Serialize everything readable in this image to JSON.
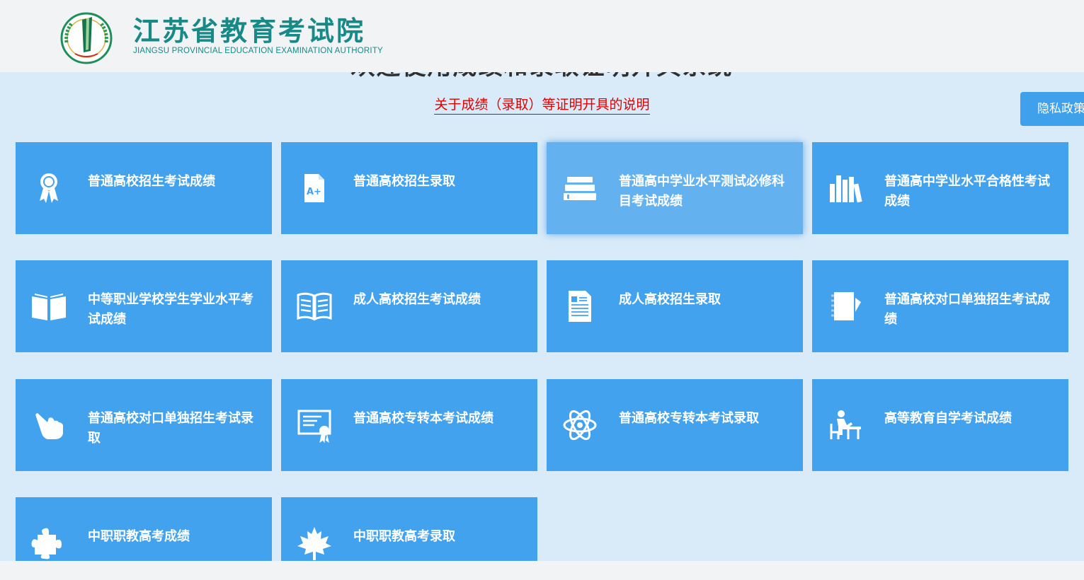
{
  "header": {
    "title_cn": "江苏省教育考试院",
    "title_en": "JIANGSU PROVINCIAL EDUCATION EXAMINATION AUTHORITY"
  },
  "main": {
    "welcome": "欢迎使用成绩和录取证明开具系统",
    "notice_link": "关于成绩（录取）等证明开具的说明",
    "privacy_button": "隐私政策"
  },
  "tiles": [
    {
      "label": "普通高校招生考试成绩",
      "icon": "award-ribbon-icon"
    },
    {
      "label": "普通高校招生录取",
      "icon": "grade-document-icon"
    },
    {
      "label": "普通高中学业水平测试必修科目考试成绩",
      "icon": "book-stack-icon"
    },
    {
      "label": "普通高中学业水平合格性考试成绩",
      "icon": "bookshelf-icon"
    },
    {
      "label": "中等职业学校学生学业水平考试成绩",
      "icon": "open-book-icon"
    },
    {
      "label": "成人高校招生考试成绩",
      "icon": "reading-book-icon"
    },
    {
      "label": "成人高校招生录取",
      "icon": "text-document-icon"
    },
    {
      "label": "普通高校对口单独招生考试成绩",
      "icon": "notebook-icon"
    },
    {
      "label": "普通高校对口单独招生考试录取",
      "icon": "pointing-hand-icon"
    },
    {
      "label": "普通高校专转本考试成绩",
      "icon": "certificate-icon"
    },
    {
      "label": "普通高校专转本考试录取",
      "icon": "atom-icon"
    },
    {
      "label": "高等教育自学考试成绩",
      "icon": "student-desk-icon"
    },
    {
      "label": "中职职教高考成绩",
      "icon": "puzzle-icon"
    },
    {
      "label": "中职职教高考录取",
      "icon": "maple-leaf-icon"
    }
  ],
  "colors": {
    "tile": "#43a2ee",
    "tile_active": "#64b1f0",
    "main_bg": "#d9ebf8",
    "brand": "#178a87",
    "notice": "#e00000"
  }
}
